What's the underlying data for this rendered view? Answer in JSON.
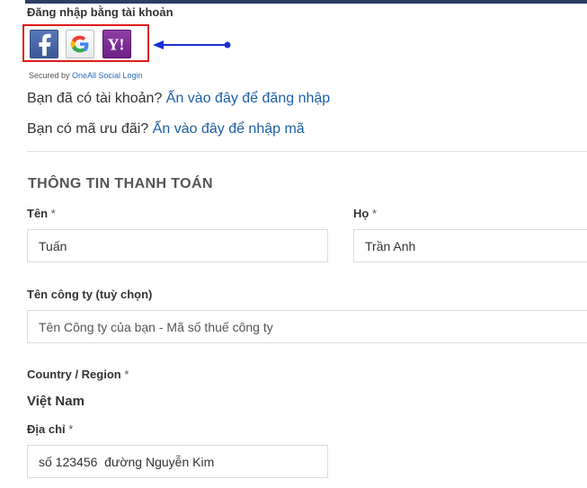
{
  "social": {
    "title": "Đăng nhập bằng tài khoản",
    "providers": [
      {
        "name": "facebook",
        "icon": "facebook-icon",
        "color": "#3b5998"
      },
      {
        "name": "google",
        "icon": "google-icon",
        "color": "#ffffff"
      },
      {
        "name": "yahoo",
        "icon": "yahoo-icon",
        "color": "#6d1f86"
      }
    ],
    "highlight_color": "#e01b1b",
    "arrow_color": "#1a2fd6",
    "secured_prefix": "Secured by ",
    "secured_link": "OneAll Social Login"
  },
  "login_prompt": {
    "text": "Bạn đã có tài khoản? ",
    "link": "Ấn vào đây để đăng nhập"
  },
  "coupon_prompt": {
    "text": "Bạn có mã ưu đãi? ",
    "link": "Ấn vào đây để nhập mã"
  },
  "billing": {
    "title": "THÔNG TIN THANH TOÁN",
    "first_name": {
      "label": "Tên",
      "required": " *",
      "value": "Tuấn"
    },
    "last_name": {
      "label": "Họ",
      "required": " *",
      "value": "Trần Anh"
    },
    "company": {
      "label": "Tên công ty (tuỳ chọn)",
      "placeholder": "Tên Công ty của bạn - Mã số thuế công ty"
    },
    "country": {
      "label": "Country / Region",
      "required": " *",
      "value": "Việt Nam"
    },
    "address": {
      "label": "Địa chỉ",
      "required": " *",
      "value": "số 123456  đường Nguyễn Kim"
    }
  }
}
